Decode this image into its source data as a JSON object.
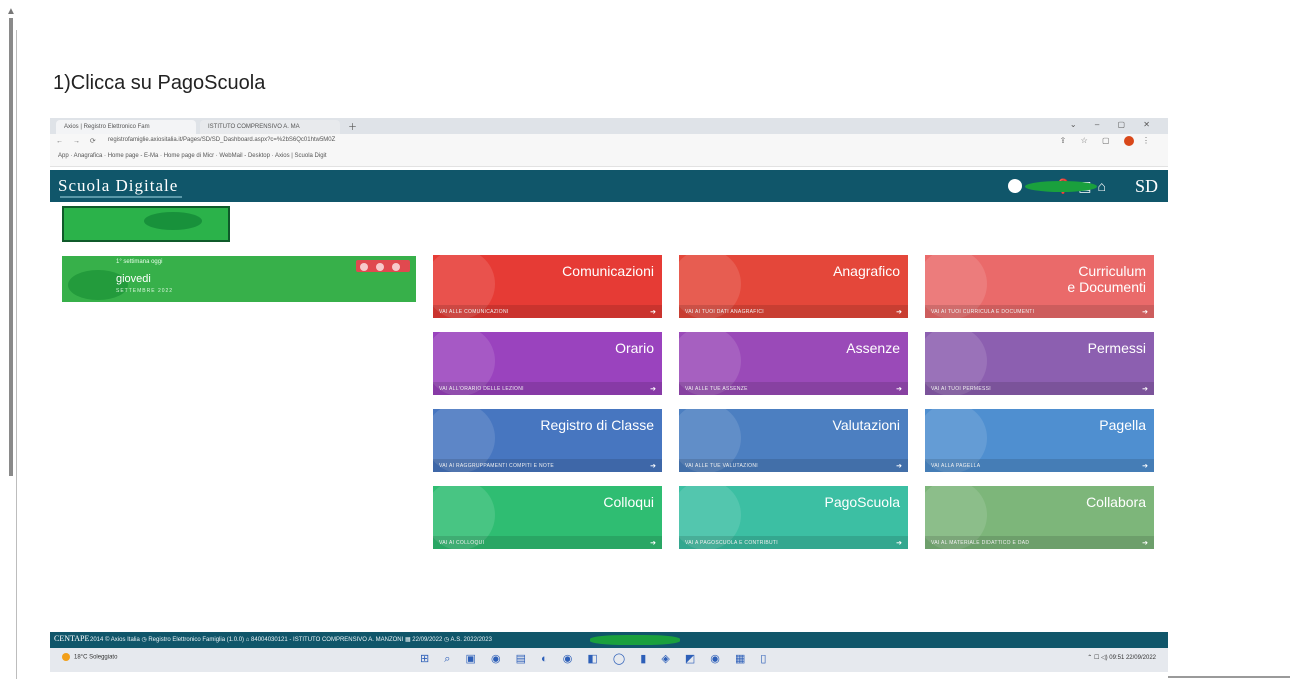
{
  "heading": "1)Clicca su PagoScuola",
  "browser": {
    "tabs": [
      "Axios | Registro Elettronico Fam",
      "ISTITUTO COMPRENSIVO A. MA"
    ],
    "url": "registrofamiglie.axiositalia.it/Pages/SD/SD_Dashboard.aspx?c=%2bS6Qc01htw5M0Z",
    "bookmarks": "App · Anagrafica · Home page - E-Ma · Home page di Micr · WebMail - Desktop · Axios | Scuola Digit"
  },
  "app": {
    "brand": "Scuola Digitale",
    "logo": "SD",
    "icons": [
      "help-icon",
      "book-icon",
      "home-icon",
      "user-icon"
    ]
  },
  "day_card": {
    "top": "1° settimana oggi",
    "day": "giovedi",
    "sub": "SETTEMBRE 2022"
  },
  "tiles": [
    {
      "title": "Comunicazioni",
      "footer": "VAI ALLE COMUNICAZIONI",
      "color": "#e63b35"
    },
    {
      "title": "Anagrafico",
      "footer": "VAI AI TUOI DATI ANAGRAFICI",
      "color": "#e4473a"
    },
    {
      "title": "Curriculum\ne Documenti",
      "footer": "VAI AI TUOI CURRICULA E DOCUMENTI",
      "color": "#ea6a6a"
    },
    {
      "title": "Orario",
      "footer": "VAI ALL'ORARIO DELLE LEZIONI",
      "color": "#9a43be"
    },
    {
      "title": "Assenze",
      "footer": "VAI ALLE TUE ASSENZE",
      "color": "#9a4ab8"
    },
    {
      "title": "Permessi",
      "footer": "VAI AI TUOI PERMESSI",
      "color": "#8c5fb0"
    },
    {
      "title": "Registro di Classe",
      "footer": "VAI AI RAGGRUPPAMENTI COMPITI E NOTE",
      "color": "#4776c0"
    },
    {
      "title": "Valutazioni",
      "footer": "VAI ALLE TUE VALUTAZIONI",
      "color": "#4c7fc1"
    },
    {
      "title": "Pagella",
      "footer": "VAI ALLA PAGELLA",
      "color": "#4f8fd0"
    },
    {
      "title": "Colloqui",
      "footer": "VAI AI COLLOQUI",
      "color": "#2fbd72"
    },
    {
      "title": "PagoScuola",
      "footer": "VAI A PAGOSCUOLA E CONTRIBUTI",
      "color": "#3cbfa3"
    },
    {
      "title": "Collabora",
      "footer": "VAI AL MATERIALE DIDATTICO E DAD",
      "color": "#7db67a"
    }
  ],
  "status_bar": {
    "logo": "CENTAPE",
    "text": "2014 © Axios Italia   ◷ Registro Elettronico Famiglia (1.0.0)   ⌂ 84004030121 - ISTITUTO COMPRENSIVO A. MANZONI                                       ▦ 22/09/2022   ◷ A.S. 2022/2023"
  },
  "taskbar": {
    "weather": "18°C Soleggiato",
    "time": "09:51",
    "date": "22/09/2022"
  }
}
